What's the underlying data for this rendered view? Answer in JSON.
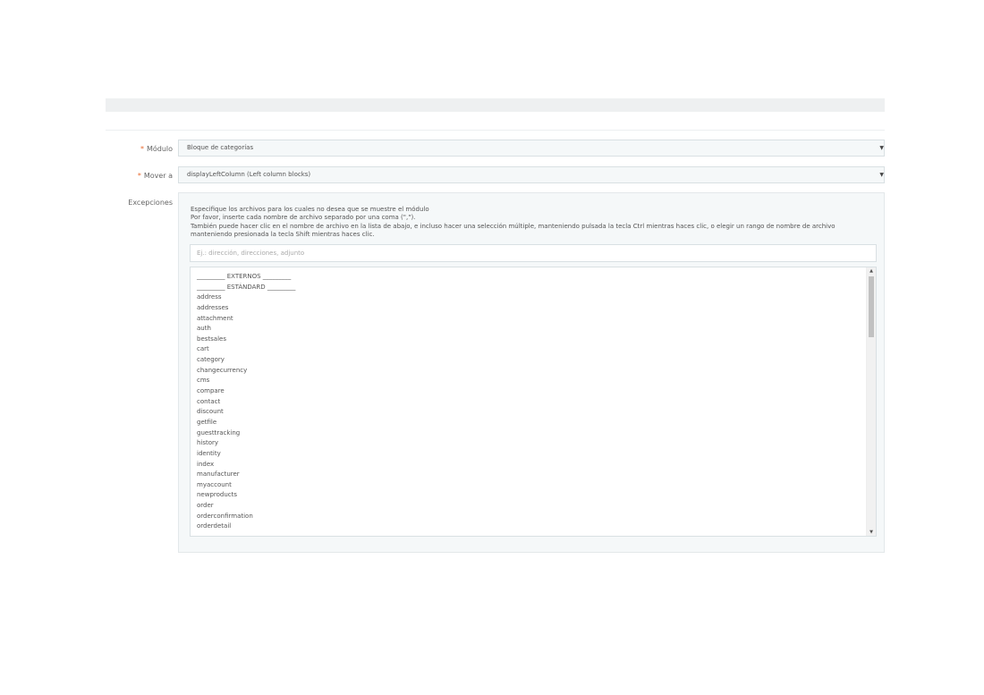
{
  "form": {
    "module_label": "Módulo",
    "module_value": "Bloque de categorías",
    "move_label": "Mover a",
    "move_value": "displayLeftColumn (Left column blocks)",
    "exceptions_label": "Excepciones",
    "required_mark": "*"
  },
  "help": [
    "Especifique los archivos para los cuales no desea que se muestre el módulo",
    "Por favor, inserte cada nombre de archivo separado por una coma (\",\").",
    "También puede hacer clic en el nombre de archivo en la lista de abajo, e incluso hacer una selección múltiple, manteniendo pulsada la tecla Ctrl mientras haces clic, o elegir un rango de nombre de archivo",
    "manteniendo presionada la tecla Shift mientras haces clic."
  ],
  "search": {
    "placeholder": "Ej.: dirección, direcciones, adjunto"
  },
  "list_items": [
    "_________ EXTERNOS _________",
    "_________ ESTÁNDARD _________",
    "address",
    "addresses",
    "attachment",
    "auth",
    "bestsales",
    "cart",
    "category",
    "changecurrency",
    "cms",
    "compare",
    "contact",
    "discount",
    "getfile",
    "guesttracking",
    "history",
    "identity",
    "index",
    "manufacturer",
    "myaccount",
    "newproducts",
    "order",
    "orderconfirmation",
    "orderdetail"
  ],
  "icons": {
    "dropdown": "caret-down-icon",
    "scroll_up": "scroll-up-icon",
    "scroll_down": "scroll-down-icon"
  }
}
